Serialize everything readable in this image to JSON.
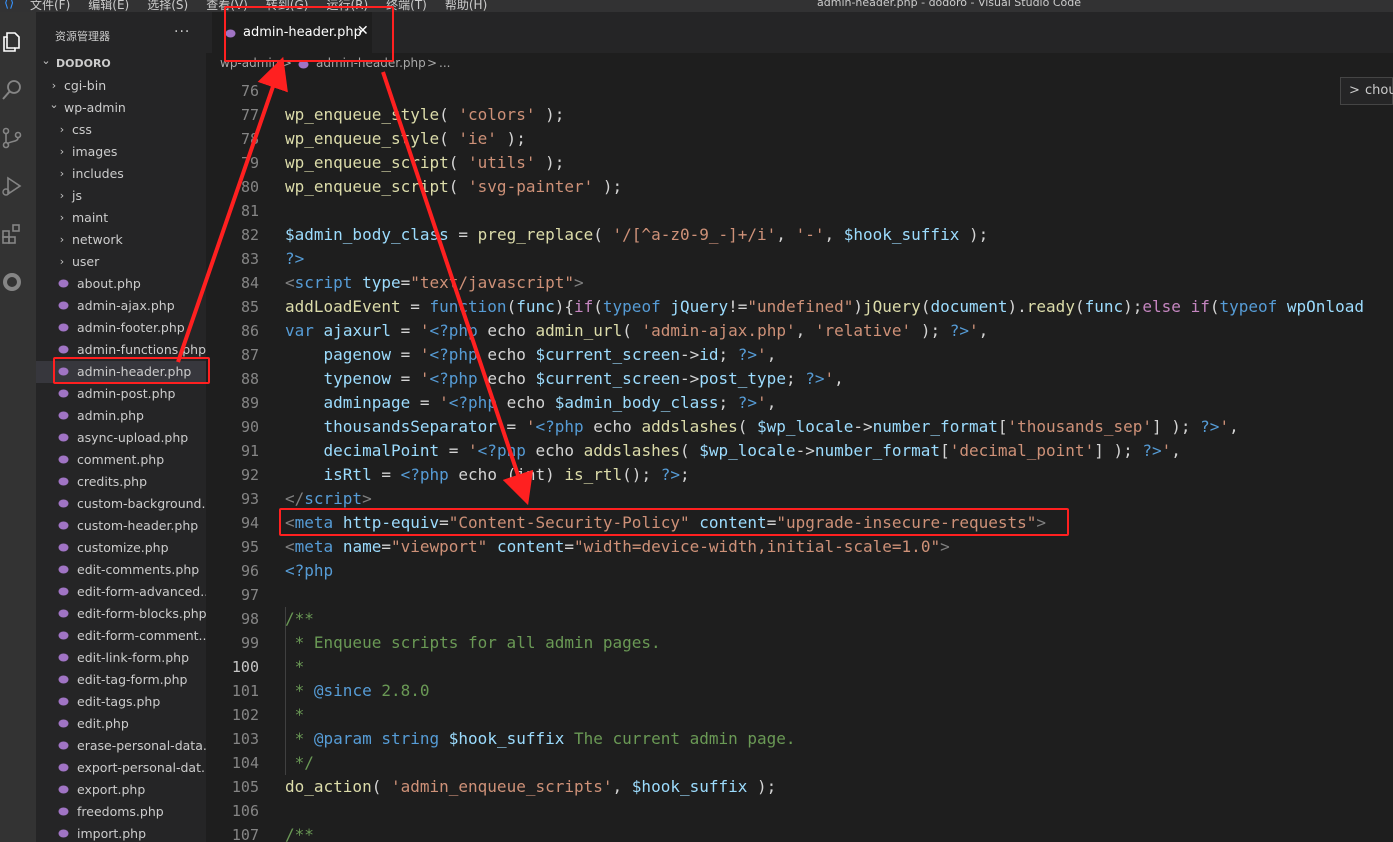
{
  "window": {
    "title": "admin-header.php - dodoro - Visual Studio Code",
    "menu": [
      "文件(F)",
      "编辑(E)",
      "选择(S)",
      "查看(V)",
      "转到(G)",
      "运行(R)",
      "终端(T)",
      "帮助(H)"
    ]
  },
  "explorer": {
    "title": "资源管理器",
    "more": "···",
    "items": [
      {
        "label": "DODORO",
        "depth": 0,
        "kind": "root"
      },
      {
        "label": "cgi-bin",
        "depth": 1,
        "kind": "folder-closed"
      },
      {
        "label": "wp-admin",
        "depth": 1,
        "kind": "folder-open"
      },
      {
        "label": "css",
        "depth": 2,
        "kind": "folder-closed"
      },
      {
        "label": "images",
        "depth": 2,
        "kind": "folder-closed"
      },
      {
        "label": "includes",
        "depth": 2,
        "kind": "folder-closed"
      },
      {
        "label": "js",
        "depth": 2,
        "kind": "folder-closed"
      },
      {
        "label": "maint",
        "depth": 2,
        "kind": "folder-closed"
      },
      {
        "label": "network",
        "depth": 2,
        "kind": "folder-closed"
      },
      {
        "label": "user",
        "depth": 2,
        "kind": "folder-closed"
      },
      {
        "label": "about.php",
        "depth": 2,
        "kind": "file"
      },
      {
        "label": "admin-ajax.php",
        "depth": 2,
        "kind": "file"
      },
      {
        "label": "admin-footer.php",
        "depth": 2,
        "kind": "file"
      },
      {
        "label": "admin-functions.php",
        "depth": 2,
        "kind": "file"
      },
      {
        "label": "admin-header.php",
        "depth": 2,
        "kind": "file",
        "selected": true
      },
      {
        "label": "admin-post.php",
        "depth": 2,
        "kind": "file"
      },
      {
        "label": "admin.php",
        "depth": 2,
        "kind": "file"
      },
      {
        "label": "async-upload.php",
        "depth": 2,
        "kind": "file"
      },
      {
        "label": "comment.php",
        "depth": 2,
        "kind": "file"
      },
      {
        "label": "credits.php",
        "depth": 2,
        "kind": "file"
      },
      {
        "label": "custom-background...",
        "depth": 2,
        "kind": "file"
      },
      {
        "label": "custom-header.php",
        "depth": 2,
        "kind": "file"
      },
      {
        "label": "customize.php",
        "depth": 2,
        "kind": "file"
      },
      {
        "label": "edit-comments.php",
        "depth": 2,
        "kind": "file"
      },
      {
        "label": "edit-form-advanced...",
        "depth": 2,
        "kind": "file"
      },
      {
        "label": "edit-form-blocks.php",
        "depth": 2,
        "kind": "file"
      },
      {
        "label": "edit-form-comment...",
        "depth": 2,
        "kind": "file"
      },
      {
        "label": "edit-link-form.php",
        "depth": 2,
        "kind": "file"
      },
      {
        "label": "edit-tag-form.php",
        "depth": 2,
        "kind": "file"
      },
      {
        "label": "edit-tags.php",
        "depth": 2,
        "kind": "file"
      },
      {
        "label": "edit.php",
        "depth": 2,
        "kind": "file"
      },
      {
        "label": "erase-personal-data....",
        "depth": 2,
        "kind": "file"
      },
      {
        "label": "export-personal-dat...",
        "depth": 2,
        "kind": "file"
      },
      {
        "label": "export.php",
        "depth": 2,
        "kind": "file"
      },
      {
        "label": "freedoms.php",
        "depth": 2,
        "kind": "file"
      },
      {
        "label": "import.php",
        "depth": 2,
        "kind": "file"
      }
    ]
  },
  "tab": {
    "label": "admin-header.php",
    "close": "✕"
  },
  "breadcrumb": {
    "folder": "wp-admin",
    "file": "admin-header.php",
    "sep": ">",
    "tail": "..."
  },
  "find_widget": {
    "chevron": ">",
    "text": "chou"
  },
  "editor": {
    "active_line": 100,
    "lines": [
      {
        "n": 76,
        "t": [
          [
            "",
            ""
          ]
        ]
      },
      {
        "n": 77,
        "t": [
          [
            "fn",
            "wp_enqueue_style"
          ],
          [
            "",
            "( "
          ],
          [
            "str",
            "'colors'"
          ],
          [
            "",
            " );"
          ]
        ]
      },
      {
        "n": 78,
        "t": [
          [
            "fn",
            "wp_enqueue_style"
          ],
          [
            "",
            "( "
          ],
          [
            "str",
            "'ie'"
          ],
          [
            "",
            " );"
          ]
        ]
      },
      {
        "n": 79,
        "t": [
          [
            "fn",
            "wp_enqueue_script"
          ],
          [
            "",
            "( "
          ],
          [
            "str",
            "'utils'"
          ],
          [
            "",
            " );"
          ]
        ]
      },
      {
        "n": 80,
        "t": [
          [
            "fn",
            "wp_enqueue_script"
          ],
          [
            "",
            "( "
          ],
          [
            "str",
            "'svg-painter'"
          ],
          [
            "",
            " );"
          ]
        ]
      },
      {
        "n": 81,
        "t": [
          [
            "",
            ""
          ]
        ]
      },
      {
        "n": 82,
        "t": [
          [
            "var",
            "$admin_body_class"
          ],
          [
            "",
            " = "
          ],
          [
            "fn",
            "preg_replace"
          ],
          [
            "",
            "( "
          ],
          [
            "str",
            "'/[^a-z0-9_-]+/i'"
          ],
          [
            "",
            ", "
          ],
          [
            "str",
            "'-'"
          ],
          [
            "",
            ", "
          ],
          [
            "var",
            "$hook_suffix"
          ],
          [
            "",
            " );"
          ]
        ]
      },
      {
        "n": 83,
        "t": [
          [
            "php",
            "?>"
          ]
        ]
      },
      {
        "n": 84,
        "t": [
          [
            "tag",
            "<"
          ],
          [
            "tagname",
            "script"
          ],
          [
            "",
            " "
          ],
          [
            "attr",
            "type"
          ],
          [
            "",
            "="
          ],
          [
            "str",
            "\"text/javascript\""
          ],
          [
            "tag",
            ">"
          ]
        ]
      },
      {
        "n": 85,
        "t": [
          [
            "fn",
            "addLoadEvent"
          ],
          [
            "",
            " = "
          ],
          [
            "kw",
            "function"
          ],
          [
            "",
            "("
          ],
          [
            "var",
            "func"
          ],
          [
            "",
            "){"
          ],
          [
            "ctl",
            "if"
          ],
          [
            "",
            "("
          ],
          [
            "kw",
            "typeof"
          ],
          [
            "",
            " "
          ],
          [
            "var",
            "jQuery"
          ],
          [
            "",
            "!="
          ],
          [
            "str",
            "\"undefined\""
          ],
          [
            "",
            ")"
          ],
          [
            "fn",
            "jQuery"
          ],
          [
            "",
            "("
          ],
          [
            "var",
            "document"
          ],
          [
            "",
            ")."
          ],
          [
            "fn",
            "ready"
          ],
          [
            "",
            "("
          ],
          [
            "var",
            "func"
          ],
          [
            "",
            ");"
          ],
          [
            "ctl",
            "else"
          ],
          [
            "",
            " "
          ],
          [
            "ctl",
            "if"
          ],
          [
            "",
            "("
          ],
          [
            "kw",
            "typeof"
          ],
          [
            "",
            " "
          ],
          [
            "var",
            "wpOnload"
          ]
        ]
      },
      {
        "n": 86,
        "t": [
          [
            "kw",
            "var"
          ],
          [
            "",
            " "
          ],
          [
            "var",
            "ajaxurl"
          ],
          [
            "",
            " = "
          ],
          [
            "str",
            "'"
          ],
          [
            "php",
            "<?php"
          ],
          [
            "",
            " echo "
          ],
          [
            "fn",
            "admin_url"
          ],
          [
            "",
            "( "
          ],
          [
            "str",
            "'admin-ajax.php'"
          ],
          [
            "",
            ", "
          ],
          [
            "str",
            "'relative'"
          ],
          [
            "",
            " ); "
          ],
          [
            "php",
            "?>"
          ],
          [
            "str",
            "'"
          ],
          [
            "",
            ","
          ]
        ]
      },
      {
        "n": 87,
        "t": [
          [
            "",
            "    "
          ],
          [
            "var",
            "pagenow"
          ],
          [
            "",
            " = "
          ],
          [
            "str",
            "'"
          ],
          [
            "php",
            "<?php"
          ],
          [
            "",
            " echo "
          ],
          [
            "var",
            "$current_screen"
          ],
          [
            "",
            "->"
          ],
          [
            "var",
            "id"
          ],
          [
            "",
            "; "
          ],
          [
            "php",
            "?>"
          ],
          [
            "str",
            "'"
          ],
          [
            "",
            ","
          ]
        ]
      },
      {
        "n": 88,
        "t": [
          [
            "",
            "    "
          ],
          [
            "var",
            "typenow"
          ],
          [
            "",
            " = "
          ],
          [
            "str",
            "'"
          ],
          [
            "php",
            "<?php"
          ],
          [
            "",
            " echo "
          ],
          [
            "var",
            "$current_screen"
          ],
          [
            "",
            "->"
          ],
          [
            "var",
            "post_type"
          ],
          [
            "",
            "; "
          ],
          [
            "php",
            "?>"
          ],
          [
            "str",
            "'"
          ],
          [
            "",
            ","
          ]
        ]
      },
      {
        "n": 89,
        "t": [
          [
            "",
            "    "
          ],
          [
            "var",
            "adminpage"
          ],
          [
            "",
            " = "
          ],
          [
            "str",
            "'"
          ],
          [
            "php",
            "<?php"
          ],
          [
            "",
            " echo "
          ],
          [
            "var",
            "$admin_body_class"
          ],
          [
            "",
            "; "
          ],
          [
            "php",
            "?>"
          ],
          [
            "str",
            "'"
          ],
          [
            "",
            ","
          ]
        ]
      },
      {
        "n": 90,
        "t": [
          [
            "",
            "    "
          ],
          [
            "var",
            "thousandsSeparator"
          ],
          [
            "",
            " = "
          ],
          [
            "str",
            "'"
          ],
          [
            "php",
            "<?php"
          ],
          [
            "",
            " echo "
          ],
          [
            "fn",
            "addslashes"
          ],
          [
            "",
            "( "
          ],
          [
            "var",
            "$wp_locale"
          ],
          [
            "",
            "->"
          ],
          [
            "var",
            "number_format"
          ],
          [
            "",
            "["
          ],
          [
            "str",
            "'thousands_sep'"
          ],
          [
            "",
            "] ); "
          ],
          [
            "php",
            "?>"
          ],
          [
            "str",
            "'"
          ],
          [
            "",
            ","
          ]
        ]
      },
      {
        "n": 91,
        "t": [
          [
            "",
            "    "
          ],
          [
            "var",
            "decimalPoint"
          ],
          [
            "",
            " = "
          ],
          [
            "str",
            "'"
          ],
          [
            "php",
            "<?php"
          ],
          [
            "",
            " echo "
          ],
          [
            "fn",
            "addslashes"
          ],
          [
            "",
            "( "
          ],
          [
            "var",
            "$wp_locale"
          ],
          [
            "",
            "->"
          ],
          [
            "var",
            "number_format"
          ],
          [
            "",
            "["
          ],
          [
            "str",
            "'decimal_point'"
          ],
          [
            "",
            "] ); "
          ],
          [
            "php",
            "?>"
          ],
          [
            "str",
            "'"
          ],
          [
            "",
            ","
          ]
        ]
      },
      {
        "n": 92,
        "t": [
          [
            "",
            "    "
          ],
          [
            "var",
            "isRtl"
          ],
          [
            "",
            " = "
          ],
          [
            "php",
            "<?php"
          ],
          [
            "",
            " echo (int) "
          ],
          [
            "fn",
            "is_rtl"
          ],
          [
            "",
            "(); "
          ],
          [
            "php",
            "?>"
          ],
          [
            "",
            ";"
          ]
        ]
      },
      {
        "n": 93,
        "t": [
          [
            "tag",
            "</"
          ],
          [
            "tagname",
            "script"
          ],
          [
            "tag",
            ">"
          ]
        ]
      },
      {
        "n": 94,
        "t": [
          [
            "tag",
            "<"
          ],
          [
            "tagname",
            "meta"
          ],
          [
            "",
            " "
          ],
          [
            "attr",
            "http-equiv"
          ],
          [
            "",
            "="
          ],
          [
            "str",
            "\"Content-Security-Policy\""
          ],
          [
            "",
            " "
          ],
          [
            "attr",
            "content"
          ],
          [
            "",
            "="
          ],
          [
            "str",
            "\"upgrade-insecure-requests\""
          ],
          [
            "tag",
            ">"
          ]
        ]
      },
      {
        "n": 95,
        "t": [
          [
            "tag",
            "<"
          ],
          [
            "tagname",
            "meta"
          ],
          [
            "",
            " "
          ],
          [
            "attr",
            "name"
          ],
          [
            "",
            "="
          ],
          [
            "str",
            "\"viewport\""
          ],
          [
            "",
            " "
          ],
          [
            "attr",
            "content"
          ],
          [
            "",
            "="
          ],
          [
            "str",
            "\"width=device-width,initial-scale=1.0\""
          ],
          [
            "tag",
            ">"
          ]
        ]
      },
      {
        "n": 96,
        "t": [
          [
            "php",
            "<?php"
          ]
        ]
      },
      {
        "n": 97,
        "t": [
          [
            "",
            ""
          ]
        ]
      },
      {
        "n": 98,
        "t": [
          [
            "cm",
            "/**"
          ]
        ]
      },
      {
        "n": 99,
        "t": [
          [
            "cm",
            " * Enqueue scripts for all admin pages."
          ]
        ]
      },
      {
        "n": 100,
        "t": [
          [
            "cm",
            " *"
          ]
        ]
      },
      {
        "n": 101,
        "t": [
          [
            "cm",
            " * "
          ],
          [
            "kw",
            "@since"
          ],
          [
            "cm",
            " 2.8.0"
          ]
        ]
      },
      {
        "n": 102,
        "t": [
          [
            "cm",
            " *"
          ]
        ]
      },
      {
        "n": 103,
        "t": [
          [
            "cm",
            " * "
          ],
          [
            "kw",
            "@param"
          ],
          [
            "cm",
            " "
          ],
          [
            "kw",
            "string"
          ],
          [
            "cm",
            " "
          ],
          [
            "var",
            "$hook_suffix"
          ],
          [
            "cm",
            " The current admin page."
          ]
        ]
      },
      {
        "n": 104,
        "t": [
          [
            "cm",
            " */"
          ]
        ]
      },
      {
        "n": 105,
        "t": [
          [
            "fn",
            "do_action"
          ],
          [
            "",
            "( "
          ],
          [
            "str",
            "'admin_enqueue_scripts'"
          ],
          [
            "",
            ", "
          ],
          [
            "var",
            "$hook_suffix"
          ],
          [
            "",
            " );"
          ]
        ]
      },
      {
        "n": 106,
        "t": [
          [
            "",
            ""
          ]
        ]
      },
      {
        "n": 107,
        "t": [
          [
            "cm",
            "/**"
          ]
        ]
      }
    ]
  }
}
